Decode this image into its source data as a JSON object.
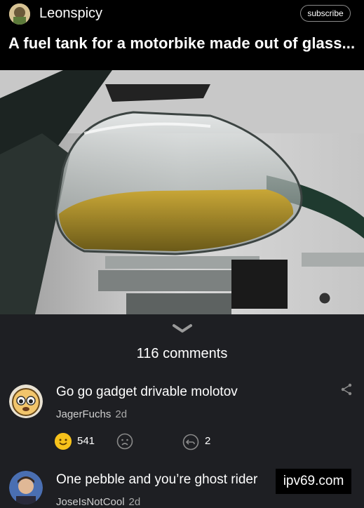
{
  "post": {
    "author": "Leonspicy",
    "subscribe_label": "subscribe",
    "title": "A fuel tank for a motorbike made out of glass..."
  },
  "comments_section": {
    "count_label": "116 comments"
  },
  "comments": [
    {
      "text": "Go go gadget drivable molotov",
      "user": "JagerFuchs",
      "age": "2d",
      "likes": "541",
      "replies": "2"
    },
    {
      "text": "One pebble and you’re ghost rider",
      "user": "JoseIsNotCool",
      "age": "2d"
    }
  ],
  "watermark": "ipv69.com",
  "colors": {
    "background": "#1e1f23",
    "topbar": "#000000",
    "like_emoji": "#f7c21b"
  }
}
